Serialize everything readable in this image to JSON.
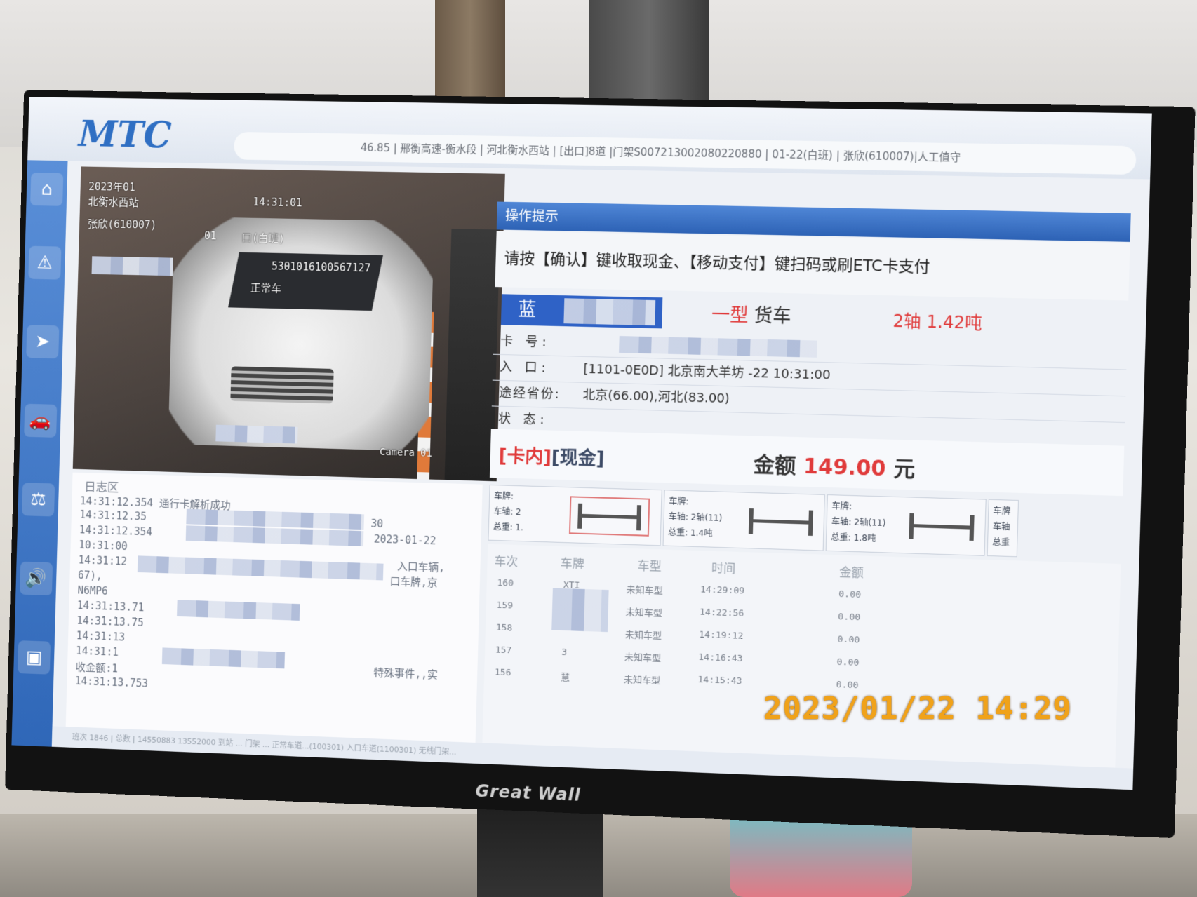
{
  "app": {
    "logo": "MTC",
    "info_bar": "46.85 | 邢衡高速-衡水段 | 河北衡水西站 | [出口]8道 |门架S007213002080220880 | 01-22(白班) | 张欣(610007)|人工值守"
  },
  "camera": {
    "ts_line1": "2023年01",
    "ts_line2": "北衡水西站",
    "ts_time": "14:31:01",
    "ts_line3": "张欣(610007)",
    "ts_line4": "01",
    "ts_line5": "口(白班)",
    "recog_plate_code": "5301016100567127",
    "recog_status": "正常车",
    "label": "Camera 01"
  },
  "log": {
    "title": "日志区",
    "lines": [
      "14:31:12.354 通行卡解析成功",
      "14:31:12.35",
      "14:31:12.354",
      "10:31:00",
      "14:31:12",
      "67),",
      "N6MP6",
      "14:31:13.71",
      "14:31:13.75",
      "14:31:13",
      "14:31:1",
      "收金额:1",
      "14:31:13.753"
    ],
    "fragments": {
      "f1": "30",
      "f2": "2023-01-22",
      "f3": "入口车辆,",
      "f4": "口车牌,京",
      "f5": "特殊事件,,实"
    }
  },
  "operation": {
    "header": "操作提示",
    "message": "请按【确认】键收取现金、【移动支付】键扫码或刷ETC卡支付"
  },
  "vehicle": {
    "plate_color": "蓝",
    "type_red": "一型",
    "type_dark": "货车",
    "axle_weight": "2轴 1.42吨",
    "rows": [
      {
        "label": "卡 号:",
        "value": ""
      },
      {
        "label": "入 口:",
        "value": "[1101-0E0D] 北京南大羊坊        -22 10:31:00"
      },
      {
        "label": "途经省份:",
        "value": "北京(66.00),河北(83.00)"
      },
      {
        "label": "状 态:",
        "value": ""
      }
    ]
  },
  "payment": {
    "kind_red": "[卡内]",
    "kind_dark": "[现金]",
    "amount_label": "金额",
    "amount_value": "149.00",
    "amount_unit": "元"
  },
  "axle_cards": [
    {
      "plate": "车牌:",
      "axles": "车轴: 2",
      "weight": "总重: 1."
    },
    {
      "plate": "车牌:",
      "axles": "车轴: 2轴(11)",
      "weight": "总重: 1.4吨"
    },
    {
      "plate": "车牌:",
      "axles": "车轴: 2轴(11)",
      "weight": "总重: 1.8吨"
    },
    {
      "plate": "车牌",
      "axles": "车轴",
      "weight": "总重"
    }
  ],
  "history": {
    "headers": [
      "车次",
      "车牌",
      "车型",
      "时间",
      "金额"
    ],
    "rows": [
      {
        "no": "160",
        "plate": "XTI",
        "type": "未知车型",
        "time": "14:29:09",
        "amount": "0.00"
      },
      {
        "no": "159",
        "plate": "",
        "type": "未知车型",
        "time": "14:22:56",
        "amount": "0.00"
      },
      {
        "no": "158",
        "plate": "",
        "type": "未知车型",
        "time": "14:19:12",
        "amount": "0.00"
      },
      {
        "no": "157",
        "plate": "3",
        "type": "未知车型",
        "time": "14:16:43",
        "amount": "0.00"
      },
      {
        "no": "156",
        "plate": "慧",
        "type": "未知车型",
        "time": "14:15:43",
        "amount": "0.00"
      }
    ]
  },
  "status_bar": "班次 1846 | 总数 | 14550883 13552000 到站 ... 门架 ... 正常车道...(100301) 入口车道(1100301) 无线门架...",
  "monitor_brand": "Great Wall",
  "photo_timestamp": "2023/01/22 14:29",
  "colors": {
    "accent_blue": "#2d62b5",
    "plate_blue": "#2f62c6",
    "alert_red": "#e03b3b",
    "stamp_orange": "#f0a21a"
  }
}
